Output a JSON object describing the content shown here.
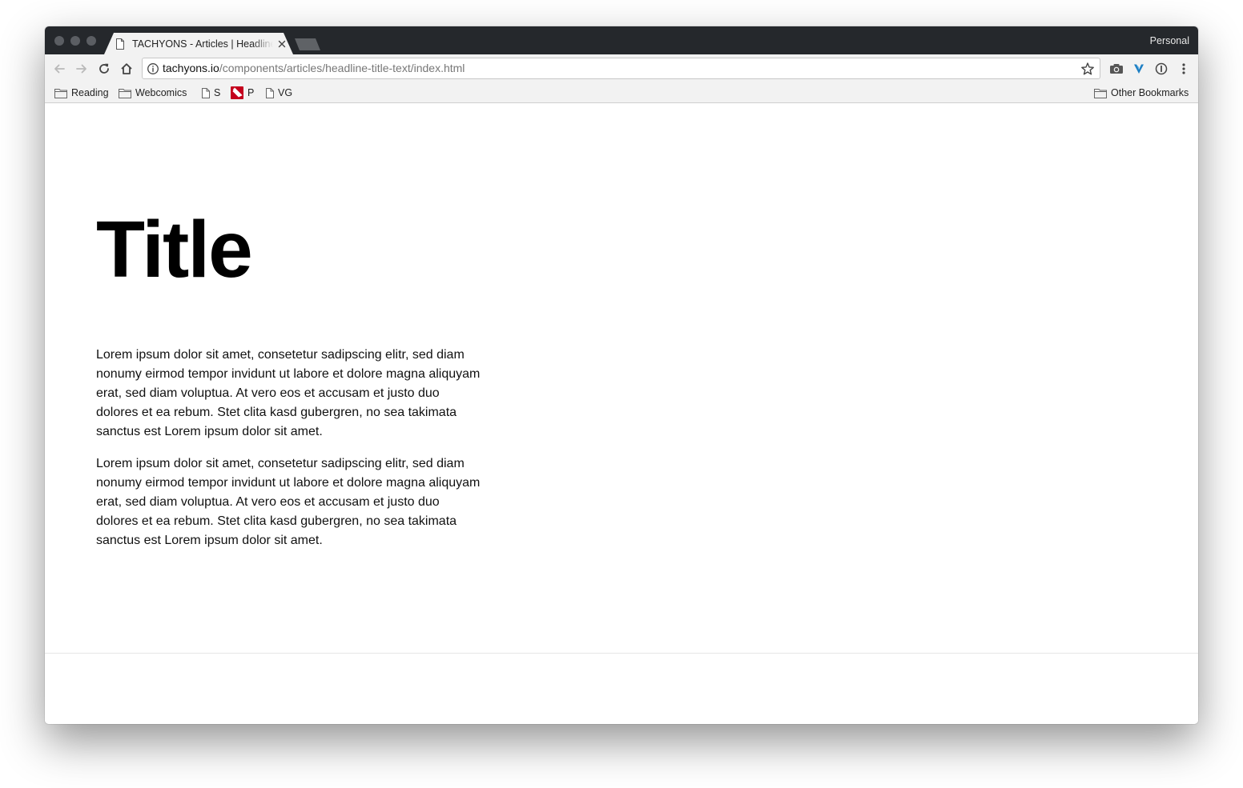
{
  "browser": {
    "profile_label": "Personal",
    "active_tab": {
      "title": "TACHYONS - Articles | Headline Title Text"
    },
    "address_bar": {
      "host": "tachyons.io",
      "path": "/components/articles/headline-title-text/index.html"
    },
    "icons": {
      "back": "arrow-left-icon",
      "forward": "arrow-right-icon",
      "reload": "reload-icon",
      "home": "home-icon",
      "site_info": "info-icon",
      "bookmark_star": "star-icon",
      "extensions": [
        "camera-icon",
        "v-logo-icon",
        "password-manager-icon"
      ],
      "menu": "kebab-menu-icon"
    },
    "bookmarks": [
      {
        "label": "Reading",
        "icon": "folder-icon"
      },
      {
        "label": "Webcomics",
        "icon": "folder-icon"
      },
      {
        "label": "S",
        "icon": "page-icon"
      },
      {
        "label": "P",
        "icon": "pin-favicon-icon"
      },
      {
        "label": "VG",
        "icon": "page-icon"
      }
    ],
    "other_bookmarks": {
      "label": "Other Bookmarks",
      "icon": "folder-icon"
    }
  },
  "article": {
    "title": "Title",
    "paragraphs": [
      "Lorem ipsum dolor sit amet, consetetur sadipscing elitr, sed diam nonumy eirmod tempor invidunt ut labore et dolore magna aliquyam erat, sed diam voluptua. At vero eos et accusam et justo duo dolores et ea rebum. Stet clita kasd gubergren, no sea takimata sanctus est Lorem ipsum dolor sit amet.",
      "Lorem ipsum dolor sit amet, consetetur sadipscing elitr, sed diam nonumy eirmod tempor invidunt ut labore et dolore magna aliquyam erat, sed diam voluptua. At vero eos et accusam et justo duo dolores et ea rebum. Stet clita kasd gubergren, no sea takimata sanctus est Lorem ipsum dolor sit amet."
    ]
  },
  "colors": {
    "tab_strip": "#25282c",
    "toolbar": "#f2f2f2",
    "traffic_light_inactive": "#5b5e63",
    "pin_favicon": "#c4001d"
  }
}
